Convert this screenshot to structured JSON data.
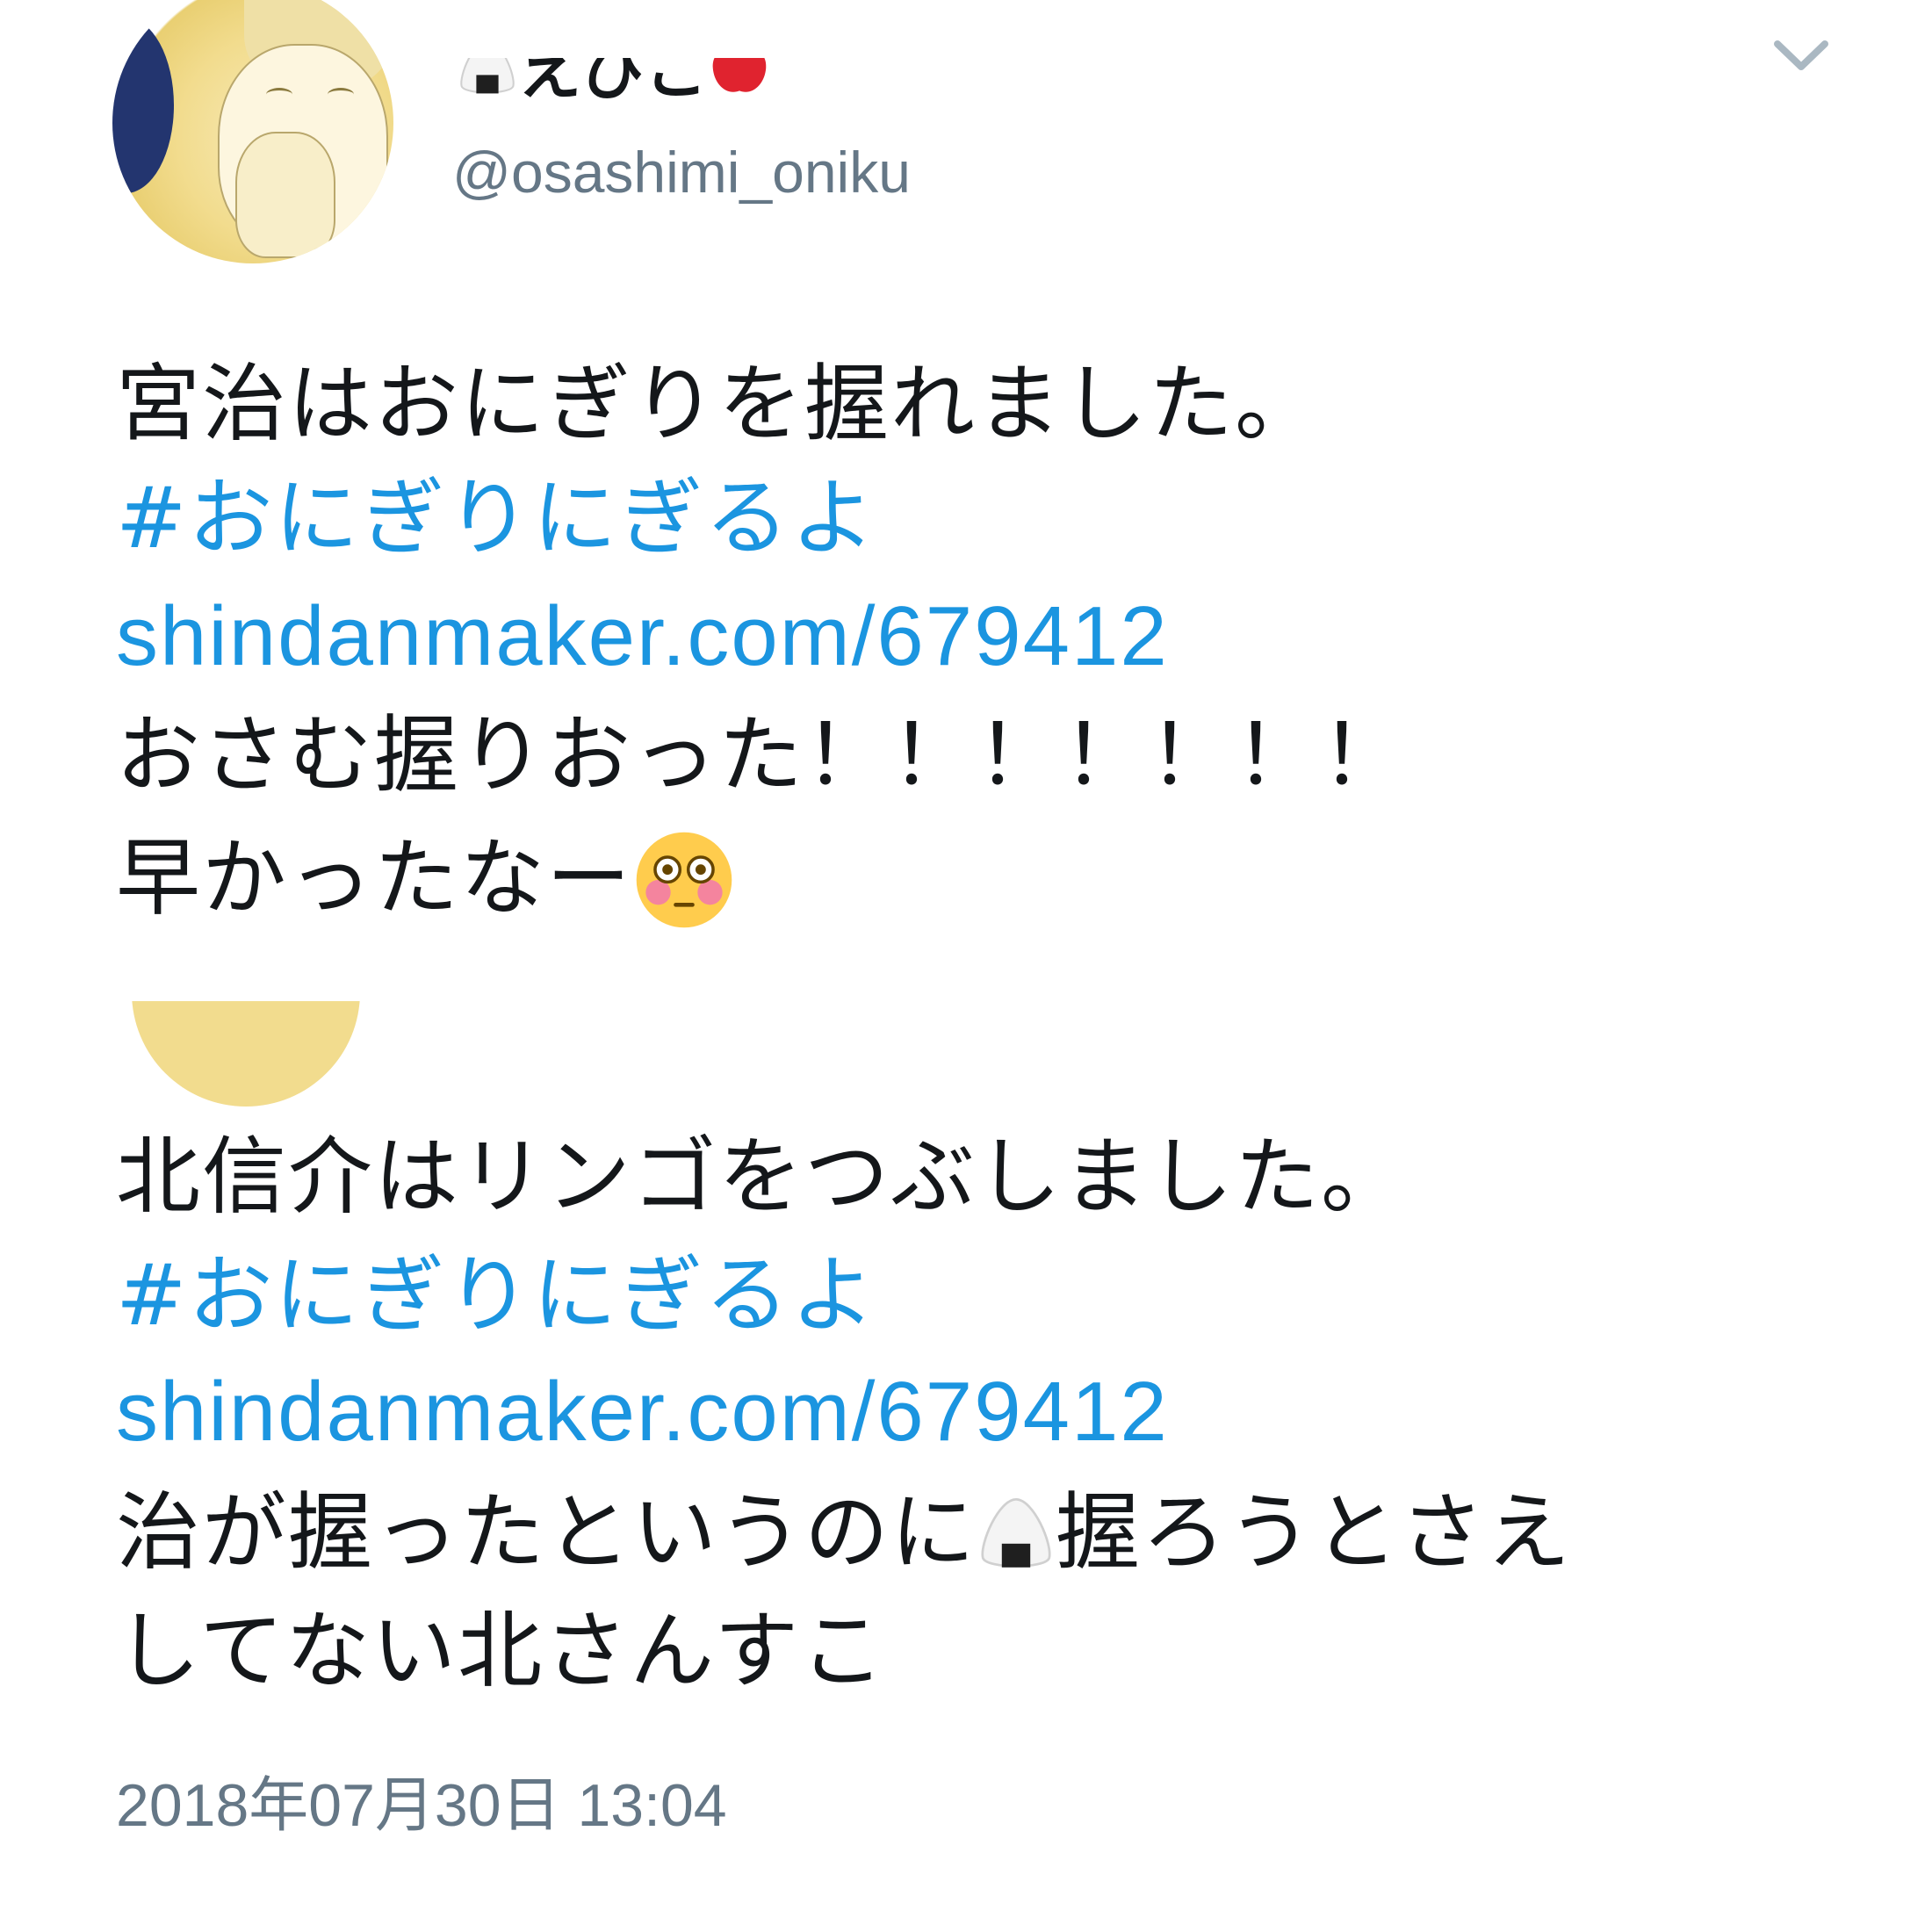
{
  "tweet": {
    "display_name_prefix_icon": "onigiri-emoji",
    "display_name": "えびこ",
    "display_name_suffix_icon": "apple-emoji",
    "handle": "@osashimi_oniku",
    "text_1": "宮治はおにぎりを握れました。",
    "hashtag_1": "#おにぎりにぎるよ",
    "url_1": "shindanmaker.com/679412",
    "text_2": "おさむ握りおった！！！！！！！",
    "text_3": "早かったなー",
    "text_3_emoji": "flushed-face-emoji",
    "quoted_text_1": "北信介はリンゴをつぶしました。",
    "hashtag_2": "#おにぎりにぎるよ",
    "url_2": "shindanmaker.com/679412",
    "text_4_before": "治が握ったというのに",
    "text_4_emoji": "onigiri-emoji",
    "text_4_after": "握ろうとさえ",
    "text_5": "してない北さんすこ",
    "timestamp": "2018年07月30日 13:04"
  },
  "colors": {
    "text": "#14171a",
    "link": "#1b95e0",
    "secondary": "#657786",
    "background": "#ffffff"
  }
}
